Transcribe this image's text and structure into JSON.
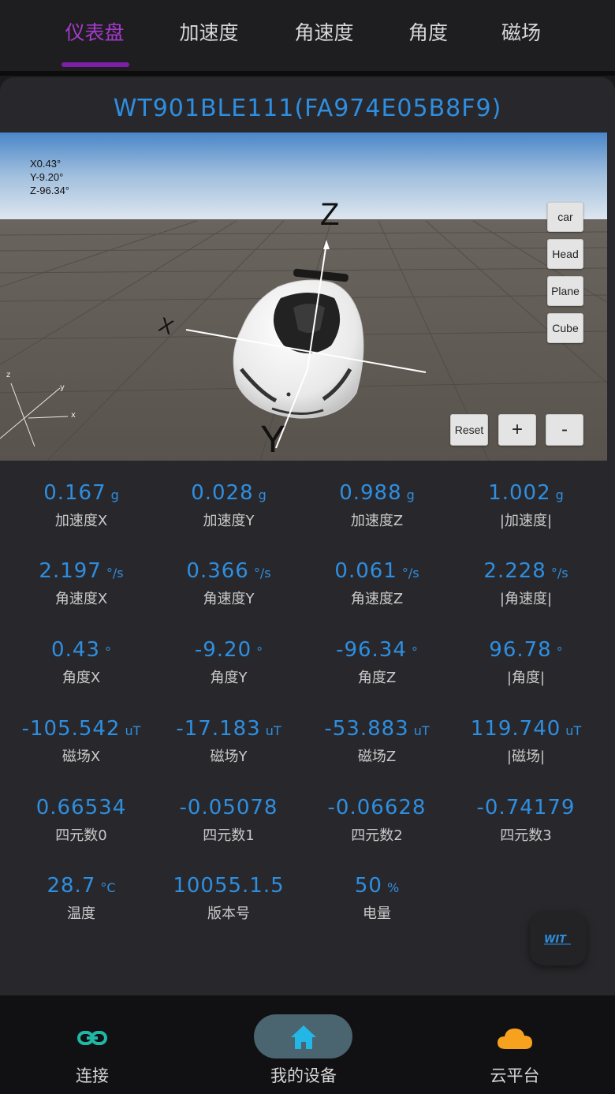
{
  "tabs": [
    {
      "label": "仪表盘",
      "active": true
    },
    {
      "label": "加速度",
      "active": false
    },
    {
      "label": "角速度",
      "active": false
    },
    {
      "label": "角度",
      "active": false
    },
    {
      "label": "磁场",
      "active": false
    }
  ],
  "device": {
    "title": "WT901BLE111(FA974E05B8F9)"
  },
  "viewer": {
    "orientation": [
      "X0.43°",
      "Y-9.20°",
      "Z-96.34°"
    ],
    "axis_labels": {
      "z": "Z",
      "x": "X",
      "y": "Y"
    },
    "mini_axes": {
      "z": "z",
      "y": "y",
      "x": "x"
    },
    "view_buttons": [
      "car",
      "Head",
      "Plane",
      "Cube"
    ],
    "reset_label": "Reset",
    "zoom_in_label": "+",
    "zoom_out_label": "-"
  },
  "metrics": [
    {
      "value": "0.167",
      "unit": "g",
      "label": "加速度X"
    },
    {
      "value": "0.028",
      "unit": "g",
      "label": "加速度Y"
    },
    {
      "value": "0.988",
      "unit": "g",
      "label": "加速度Z"
    },
    {
      "value": "1.002",
      "unit": "g",
      "label": "|加速度|"
    },
    {
      "value": "2.197",
      "unit": "°/s",
      "label": "角速度X"
    },
    {
      "value": "0.366",
      "unit": "°/s",
      "label": "角速度Y"
    },
    {
      "value": "0.061",
      "unit": "°/s",
      "label": "角速度Z"
    },
    {
      "value": "2.228",
      "unit": "°/s",
      "label": "|角速度|"
    },
    {
      "value": "0.43",
      "unit": "°",
      "label": "角度X"
    },
    {
      "value": "-9.20",
      "unit": "°",
      "label": "角度Y"
    },
    {
      "value": "-96.34",
      "unit": "°",
      "label": "角度Z"
    },
    {
      "value": "96.78",
      "unit": "°",
      "label": "|角度|"
    },
    {
      "value": "-105.542",
      "unit": "uT",
      "label": "磁场X"
    },
    {
      "value": "-17.183",
      "unit": "uT",
      "label": "磁场Y"
    },
    {
      "value": "-53.883",
      "unit": "uT",
      "label": "磁场Z"
    },
    {
      "value": "119.740",
      "unit": "uT",
      "label": "|磁场|"
    },
    {
      "value": "0.66534",
      "unit": "",
      "label": "四元数0"
    },
    {
      "value": "-0.05078",
      "unit": "",
      "label": "四元数1"
    },
    {
      "value": "-0.06628",
      "unit": "",
      "label": "四元数2"
    },
    {
      "value": "-0.74179",
      "unit": "",
      "label": "四元数3"
    },
    {
      "value": "28.7",
      "unit": "°C",
      "label": "温度"
    },
    {
      "value": "10055.1.5",
      "unit": "",
      "label": "版本号"
    },
    {
      "value": "50",
      "unit": "%",
      "label": "电量"
    }
  ],
  "fab": {
    "logo_text": "WIT",
    "icon": "wit-logo-icon"
  },
  "bottom_nav": [
    {
      "label": "连接",
      "icon": "link-icon",
      "active": false
    },
    {
      "label": "我的设备",
      "icon": "home-icon",
      "active": true
    },
    {
      "label": "云平台",
      "icon": "cloud-icon",
      "active": false
    }
  ],
  "colors": {
    "accent_purple": "#a33bc9",
    "value_blue": "#2e8ee0",
    "link_teal": "#1fb8a6",
    "home_cyan": "#23b7e5",
    "cloud_orange": "#f6a21e",
    "background": "#1b1b1d",
    "card": "#28282c"
  }
}
